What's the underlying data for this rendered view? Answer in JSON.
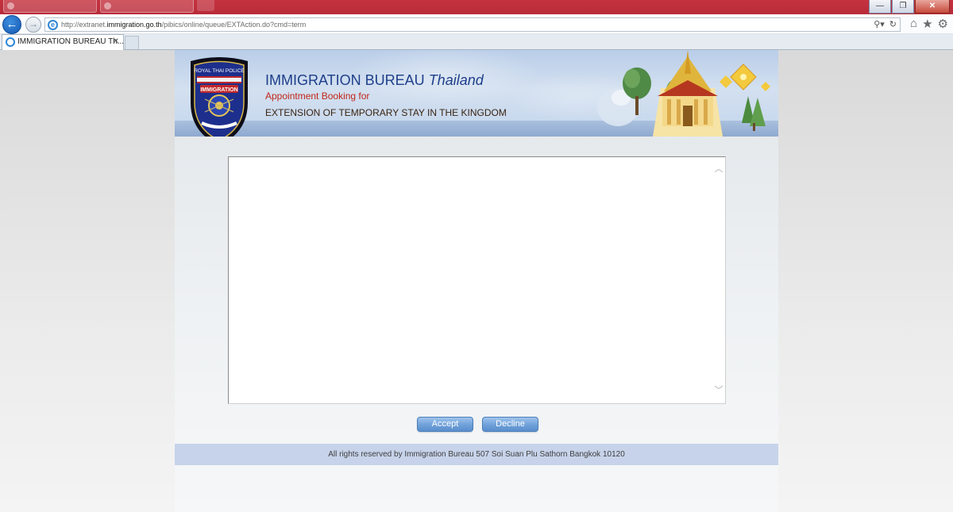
{
  "browser": {
    "window_buttons": {
      "minimize": "—",
      "restore": "❐",
      "close": "✕"
    },
    "address": {
      "url_prefix": "http://extranet.",
      "url_domain": "immigration.go.th",
      "url_suffix": "/pibics/online/queue/EXTAction.do?cmd=term"
    },
    "active_tab": {
      "title": "IMMIGRATION BUREAU Th..."
    },
    "icons": [
      "back-arrow-icon",
      "forward-arrow-icon",
      "ie-icon",
      "search-icon",
      "refresh-icon",
      "home-icon",
      "favorites-star-icon",
      "gear-icon"
    ]
  },
  "banner": {
    "badge_top": "ROYAL THAI POLICE",
    "badge_mid": "IMMIGRATION",
    "title_part1": "IMMIGRATION BUREAU",
    "title_part2": "Thailand",
    "subtitle1": "Appointment Booking for",
    "subtitle2": "EXTENSION OF TEMPORARY STAY IN THE KINGDOM"
  },
  "terms_box": {
    "content": ""
  },
  "actions": {
    "accept_label": "Accept",
    "decline_label": "Decline"
  },
  "footer": {
    "text": "All rights reserved by Immigration Bureau 507 Soi Suan Plu Sathorn Bangkok 10120"
  },
  "colors": {
    "title_blue": "#1e3f8a",
    "subtitle_red": "#c2261a",
    "button_blue": "#6fa0d9",
    "footer_band": "#c7d3ea",
    "titlebar_red": "#b92b39"
  }
}
